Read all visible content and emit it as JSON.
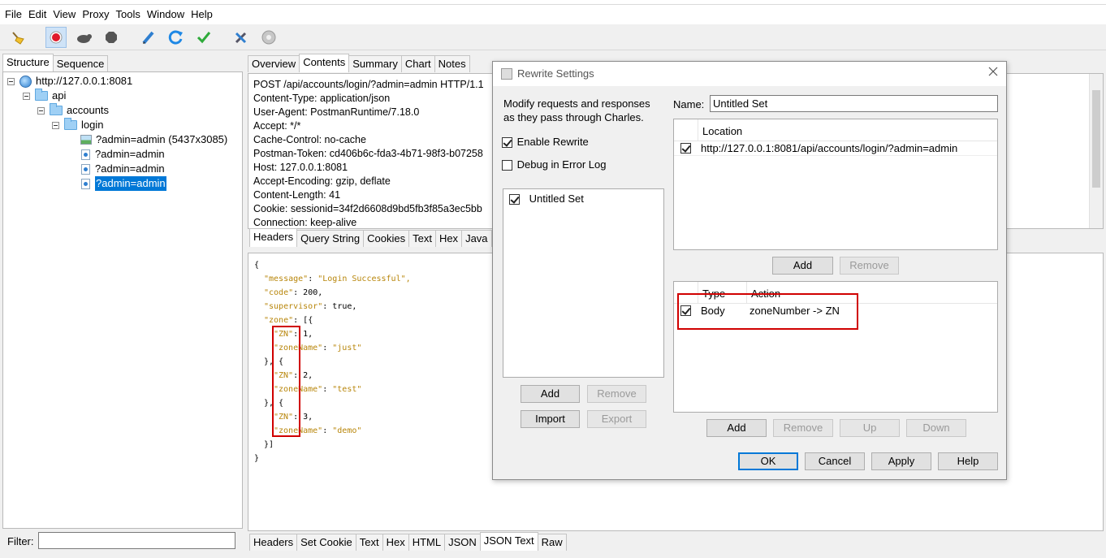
{
  "menu": [
    "File",
    "Edit",
    "View",
    "Proxy",
    "Tools",
    "Window",
    "Help"
  ],
  "toolbar": {
    "icons": [
      "broom-icon",
      "record-icon",
      "throttle-icon",
      "breakpoint-icon",
      "compose-icon",
      "repeat-icon",
      "validate-icon",
      "tools-icon",
      "settings-icon"
    ]
  },
  "left": {
    "tabs": [
      "Structure",
      "Sequence"
    ],
    "tree": {
      "host": "http://127.0.0.1:8081",
      "api": "api",
      "accounts": "accounts",
      "login": "login",
      "requests": [
        "?admin=admin (5437x3085)",
        "?admin=admin",
        "?admin=admin",
        "?admin=admin"
      ]
    },
    "filter_label": "Filter:",
    "filter_value": ""
  },
  "right": {
    "tabs": [
      "Overview",
      "Contents",
      "Summary",
      "Chart",
      "Notes"
    ],
    "request_lines": [
      "POST /api/accounts/login/?admin=admin HTTP/1.1",
      "Content-Type: application/json",
      "User-Agent: PostmanRuntime/7.18.0",
      "Accept: */*",
      "Cache-Control: no-cache",
      "Postman-Token: cd406b6c-fda3-4b71-98f3-b07258",
      "Host: 127.0.0.1:8081",
      "Accept-Encoding: gzip, deflate",
      "Content-Length: 41",
      "Cookie: sessionid=34f2d6608d9bd5fb3f85a3ec5bb",
      "Connection: keep-alive"
    ],
    "request_tabs": [
      "Headers",
      "Query String",
      "Cookies",
      "Text",
      "Hex",
      "Java"
    ],
    "response_tabs": [
      "Headers",
      "Set Cookie",
      "Text",
      "Hex",
      "HTML",
      "JSON",
      "JSON Text",
      "Raw"
    ],
    "json": {
      "open": "{",
      "message_key": "\"message\"",
      "message_val": "\"Login Successful\",",
      "code_key": "\"code\"",
      "code_val": "200,",
      "supervisor_key": "\"supervisor\"",
      "supervisor_val": "true,",
      "zone_key": "\"zone\"",
      "zone_open": "[{",
      "zn_key": "\"ZN\"",
      "zn_vals": [
        "1,",
        "2,",
        "3,"
      ],
      "zonename_key": "\"zoneName\"",
      "zonename_vals": [
        "\"just\"",
        "\"test\"",
        "\"demo\""
      ],
      "sep": "}, {",
      "arr_close": "}]",
      "close": "}"
    }
  },
  "dialog": {
    "title": "Rewrite Settings",
    "description_1": "Modify requests and responses",
    "description_2": "as they pass through Charles.",
    "enable_label": "Enable Rewrite",
    "enable_checked": true,
    "debug_label": "Debug in Error Log",
    "debug_checked": false,
    "sets": [
      "Untitled Set"
    ],
    "set_buttons": {
      "add": "Add",
      "remove": "Remove",
      "import": "Import",
      "export": "Export"
    },
    "name_label": "Name:",
    "name_value": "Untitled Set",
    "location_header": "Location",
    "locations": [
      "http://127.0.0.1:8081/api/accounts/login/?admin=admin"
    ],
    "location_buttons": {
      "add": "Add",
      "remove": "Remove"
    },
    "rules_headers": {
      "type": "Type",
      "action": "Action"
    },
    "rules": [
      {
        "type": "Body",
        "action": "zoneNumber -> ZN"
      }
    ],
    "rule_buttons": {
      "add": "Add",
      "remove": "Remove",
      "up": "Up",
      "down": "Down"
    },
    "footer": {
      "ok": "OK",
      "cancel": "Cancel",
      "apply": "Apply",
      "help": "Help"
    }
  },
  "colors": {
    "selection": "#0078d7",
    "highlight_box": "#d00000",
    "json_string": "#b8860b"
  }
}
